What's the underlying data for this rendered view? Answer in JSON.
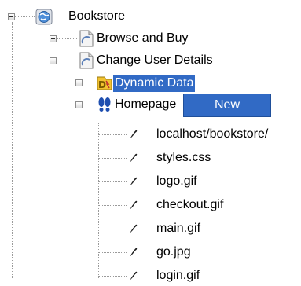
{
  "tree": {
    "root": {
      "label": "Bookstore",
      "icon": "globe-icon"
    },
    "nodes": [
      {
        "label": "Browse and Buy",
        "icon": "page-icon",
        "expander": "plus"
      },
      {
        "label": "Change User Details",
        "icon": "page-icon",
        "expander": "minus"
      },
      {
        "label": "Dynamic Data",
        "icon": "dynamic-data-icon",
        "expander": "plus",
        "selected": true
      },
      {
        "label": "Homepage",
        "icon": "footprints-icon",
        "expander": "minus"
      }
    ],
    "requests": [
      "localhost/bookstore/",
      "styles.css",
      "logo.gif",
      "checkout.gif",
      "main.gif",
      "go.jpg",
      "login.gif"
    ],
    "request_icon": "request-icon"
  },
  "context_menu": {
    "items": [
      "New"
    ]
  },
  "colors": {
    "selection": "#316ac5",
    "tree_lines": "#9a9a9a"
  }
}
